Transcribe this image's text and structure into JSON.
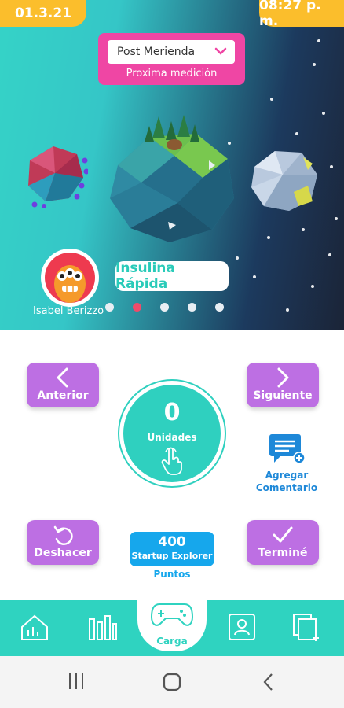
{
  "header": {
    "date": "01.3.21",
    "time": "08:27 p. m."
  },
  "measurement": {
    "selected": "Post Merienda",
    "caption": "Proxima medición"
  },
  "user": {
    "name": "Isabel Berizzo"
  },
  "insulin_label": "Insulina Rápida",
  "carousel": {
    "count": 5,
    "active_index": 1
  },
  "controls": {
    "previous": "Anterior",
    "next": "Siguiente",
    "undo": "Deshacer",
    "done": "Terminé",
    "comment": "Agregar Comentario"
  },
  "dose": {
    "value": "0",
    "unit": "Unidades"
  },
  "points": {
    "value": "400",
    "name": "Startup Explorer",
    "label": "Puntos"
  },
  "nav": {
    "center_label": "Carga"
  },
  "colors": {
    "accent": "#2fd3c0",
    "purple": "#bd6fe3",
    "pink": "#ef46a4",
    "yellow": "#fbbe2c",
    "blue": "#16a7ec"
  }
}
